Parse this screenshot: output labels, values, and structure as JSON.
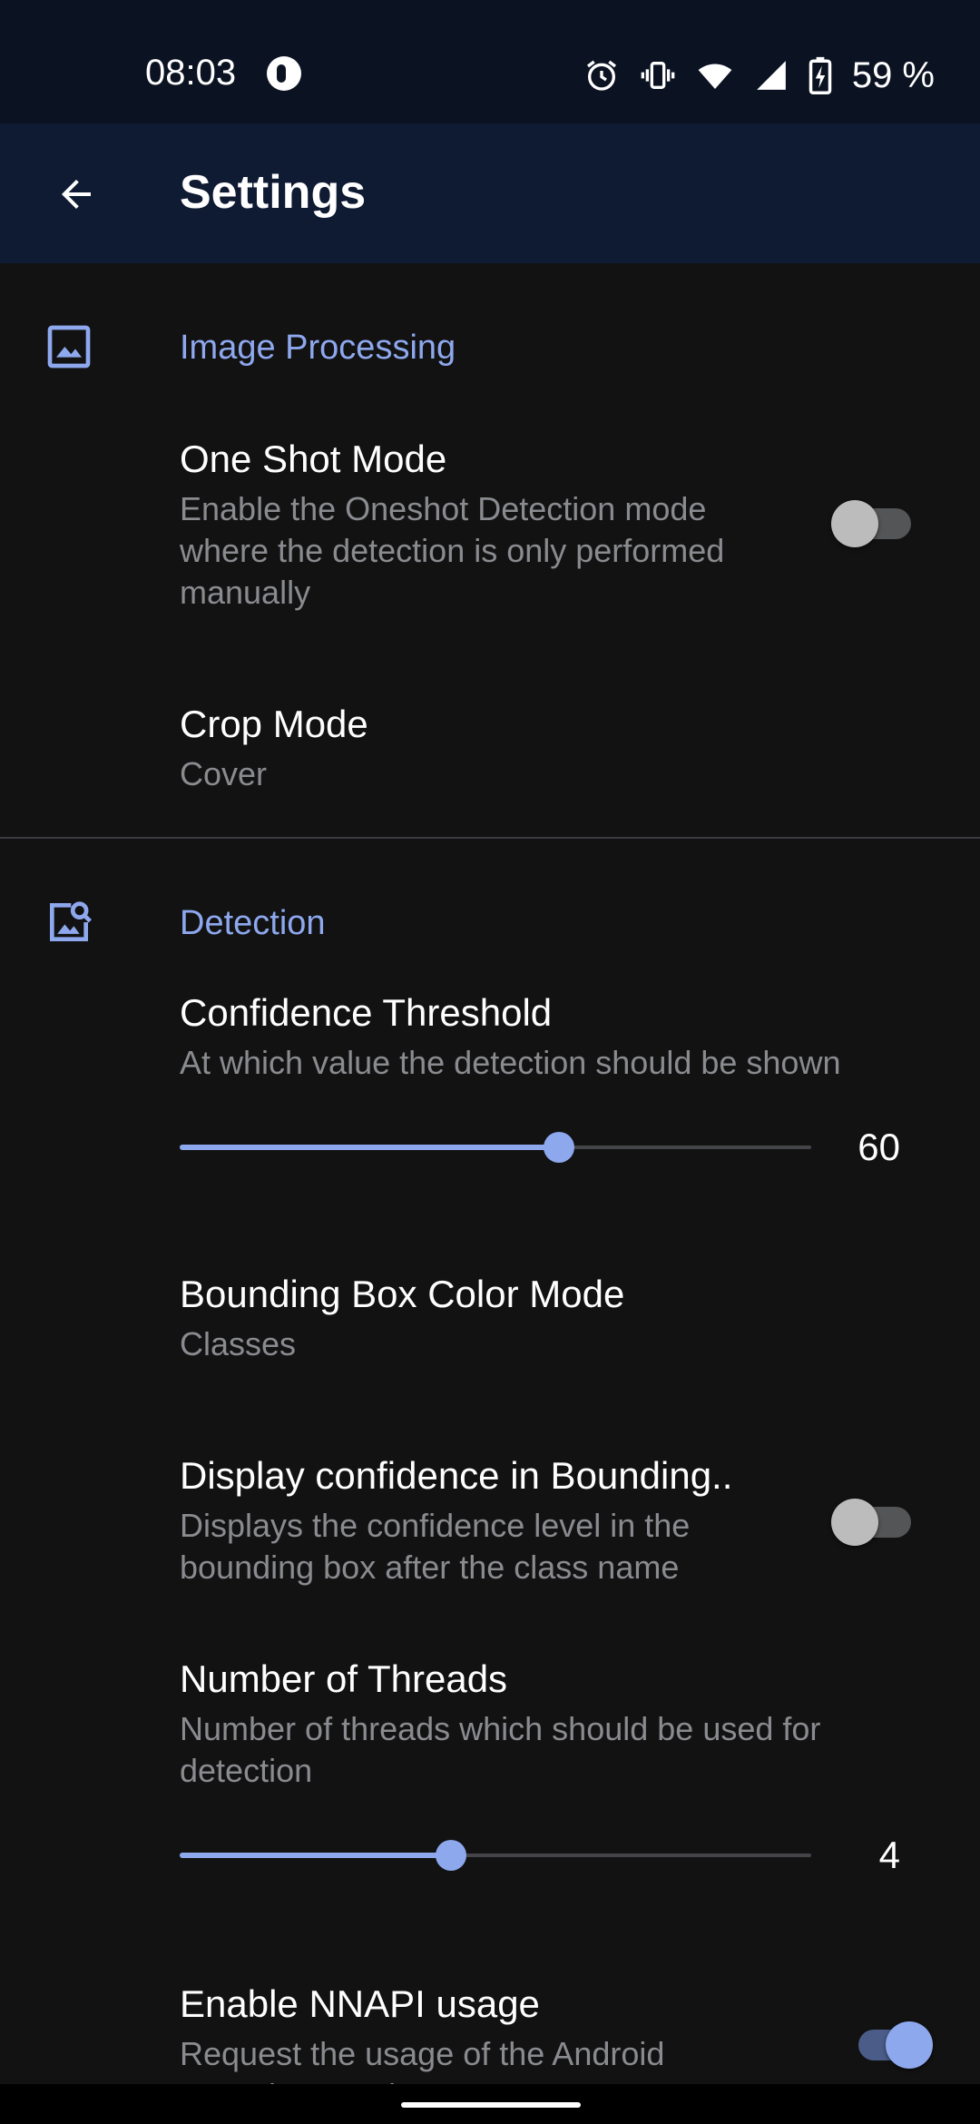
{
  "status": {
    "time": "08:03",
    "battery": "59 %",
    "icons": [
      "notification-icon",
      "alarm-icon",
      "vibrate-icon",
      "wifi-icon",
      "signal-icon",
      "battery-charging-icon"
    ]
  },
  "appbar": {
    "title": "Settings",
    "back_icon": "arrow-back-icon"
  },
  "sections": {
    "image_processing": {
      "title": "Image Processing",
      "icon": "image-icon",
      "one_shot": {
        "title": "One Shot Mode",
        "summary_1": "Enable the Oneshot Detection mode",
        "summary_2": "where the detection is only performed",
        "summary_3": "manually",
        "enabled": false
      },
      "crop_mode": {
        "title": "Crop Mode",
        "value": "Cover"
      }
    },
    "detection": {
      "title": "Detection",
      "icon": "image-search-icon",
      "confidence": {
        "title": "Confidence Threshold",
        "summary": "At which value the detection should be shown",
        "value": "60",
        "fraction": 0.6
      },
      "bbox_color": {
        "title": "Bounding Box Color Mode",
        "value": "Classes"
      },
      "display_confidence": {
        "title": "Display confidence in Bounding..",
        "summary_1": "Displays the confidence level in the",
        "summary_2": "bounding box after the class name",
        "enabled": false
      },
      "threads": {
        "title": "Number of Threads",
        "summary_1": "Number of threads which should be used for",
        "summary_2": "detection",
        "value": "4",
        "fraction": 0.43
      },
      "nnapi": {
        "title": "Enable NNAPI usage",
        "summary_1": "Request the usage of the Android",
        "summary_2": "Neural Networks API",
        "enabled": true
      }
    }
  },
  "colors": {
    "accent": "#8ea8ee",
    "background": "#121213",
    "appbar": "#0f1a33",
    "statusbar": "#0b1222"
  }
}
